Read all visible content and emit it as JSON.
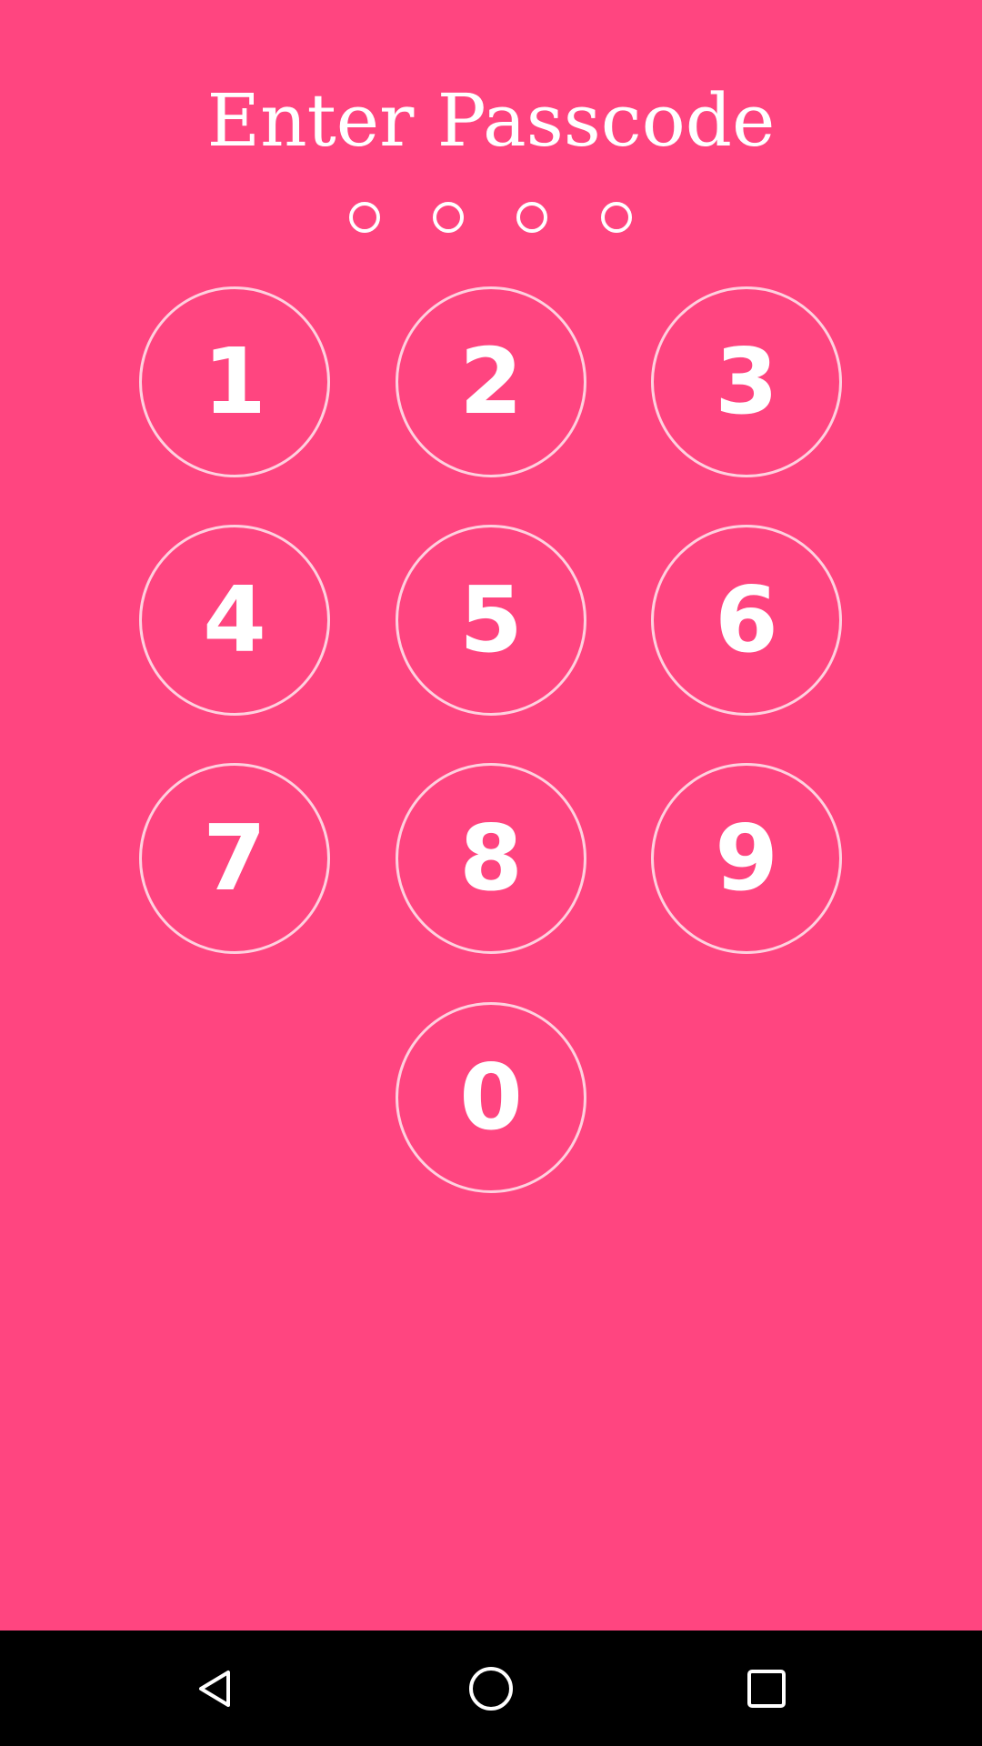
{
  "title": "Enter Passcode",
  "passcode_length": 4,
  "entered_digits": 0,
  "keypad": {
    "keys": [
      "1",
      "2",
      "3",
      "4",
      "5",
      "6",
      "7",
      "8",
      "9",
      "0"
    ]
  },
  "nav": {
    "back": "back-icon",
    "home": "home-icon",
    "recents": "recents-icon"
  },
  "colors": {
    "background": "#ff4580",
    "text": "#ffffff",
    "key_border": "#ffd0de",
    "navbar": "#000000"
  }
}
